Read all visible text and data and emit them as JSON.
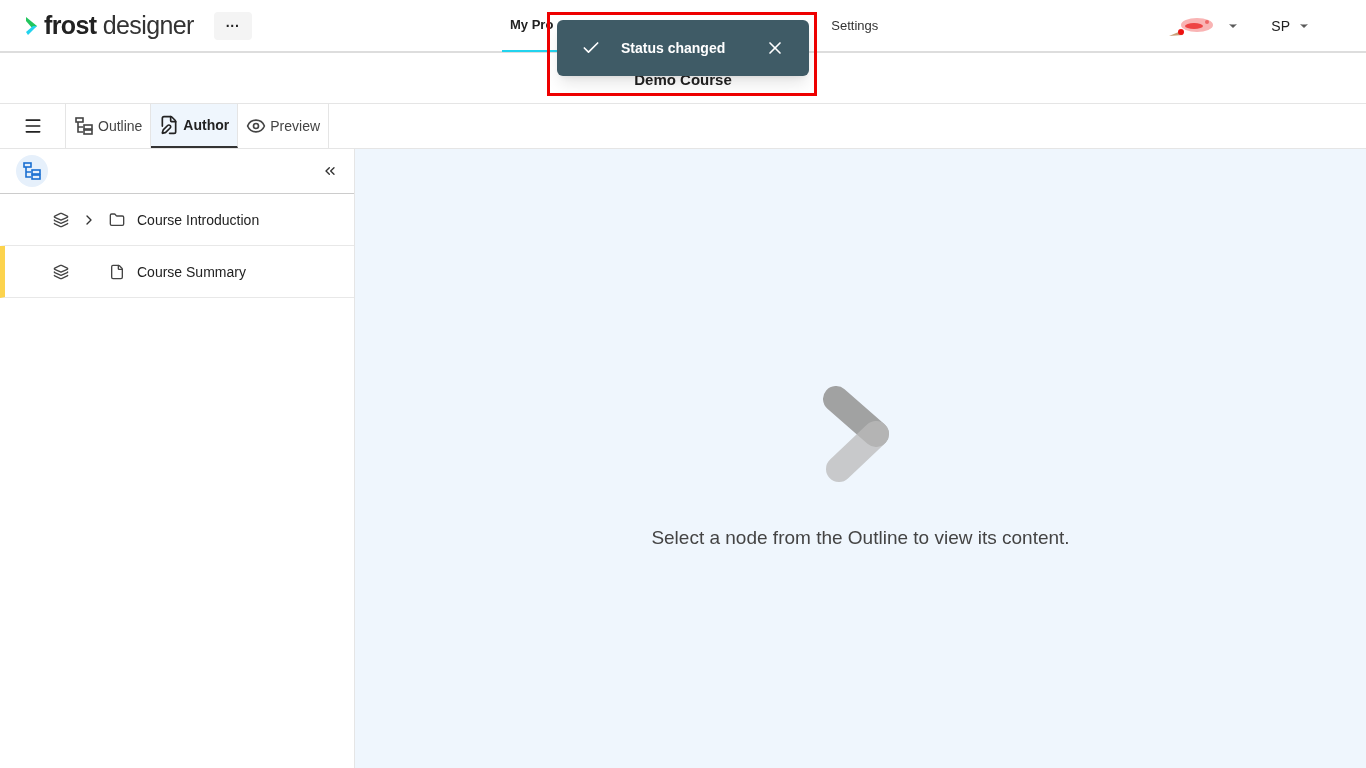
{
  "header": {
    "logo": {
      "brand": "frost",
      "product": "designer"
    },
    "more_button": "···",
    "nav": [
      {
        "label": "My Pro",
        "selected": true
      },
      {
        "label": "Settings",
        "selected": false
      }
    ],
    "user": {
      "initials": "SP"
    }
  },
  "toast": {
    "message": "Status changed"
  },
  "course_title": "Demo Course",
  "tabs": [
    {
      "label": "Outline",
      "selected": false
    },
    {
      "label": "Author",
      "selected": true
    },
    {
      "label": "Preview",
      "selected": false
    }
  ],
  "outline": [
    {
      "kind": "folder",
      "label": "Course Introduction",
      "expanded": false,
      "selected": false
    },
    {
      "kind": "page",
      "label": "Course Summary",
      "selected": true
    }
  ],
  "empty_state": {
    "message": "Select a node from the Outline to view its content."
  }
}
